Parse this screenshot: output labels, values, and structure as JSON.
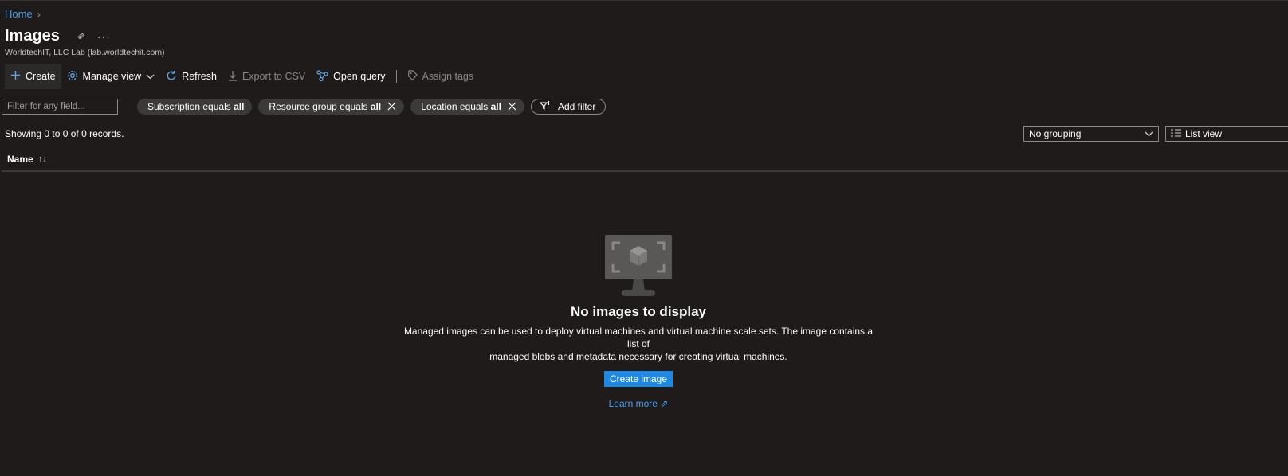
{
  "breadcrumb": {
    "home": "Home",
    "sep": "›"
  },
  "header": {
    "title": "Images",
    "pin": "✐",
    "more": "···",
    "subtitle": "WorldtechIT, LLC Lab (lab.worldtechit.com)"
  },
  "toolbar": {
    "create": "Create",
    "manage_view": "Manage view",
    "refresh": "Refresh",
    "export_csv": "Export to CSV",
    "open_query": "Open query",
    "assign_tags": "Assign tags"
  },
  "filters": {
    "placeholder": "Filter for any field...",
    "subscription_label": "Subscription equals",
    "subscription_value": "all",
    "resource_group_label": "Resource group equals",
    "resource_group_value": "all",
    "location_label": "Location equals",
    "location_value": "all",
    "add_filter": "Add filter"
  },
  "list": {
    "records": "Showing 0 to 0 of 0 records.",
    "grouping": "No grouping",
    "view": "List view",
    "columns": {
      "name": "Name",
      "sort": "↑↓"
    }
  },
  "empty_state": {
    "title": "No images to display",
    "description_line1": "Managed images can be used to deploy virtual machines and virtual machine scale sets. The image contains a list of",
    "description_line2": "managed blobs and metadata necessary for creating virtual machines.",
    "button": "Create image",
    "learn_more": "Learn more ⇗"
  },
  "colors": {
    "background": "#1f1b1a",
    "accent": "#1e88e5",
    "link": "#4ba0f0"
  }
}
